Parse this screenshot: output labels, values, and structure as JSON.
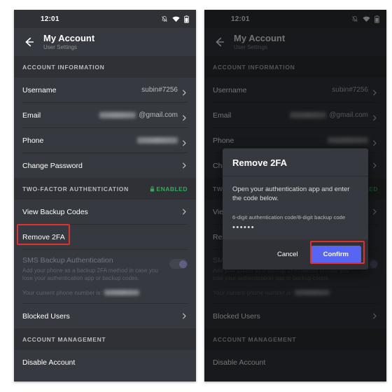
{
  "status_bar": {
    "time": "12:01",
    "icons": [
      "bell-muted-icon",
      "wifi-icon",
      "battery-icon"
    ]
  },
  "header": {
    "back_icon": "back-arrow-icon",
    "title": "My Account",
    "subtitle": "User Settings"
  },
  "sections": {
    "account_information": {
      "heading": "ACCOUNT INFORMATION",
      "rows": [
        {
          "label": "Username",
          "value": "subin#7256",
          "redacted": false,
          "chevron": true
        },
        {
          "label": "Email",
          "value": "@gmail.com",
          "redacted": true,
          "chevron": true
        },
        {
          "label": "Phone",
          "value": "",
          "redacted": true,
          "chevron": true
        },
        {
          "label": "Change Password",
          "value": "",
          "redacted": false,
          "chevron": true
        }
      ]
    },
    "two_factor": {
      "heading": "TWO-FACTOR AUTHENTICATION",
      "status_badge": "ENABLED",
      "status_icon": "lock-icon",
      "status_color": "#3ba55d",
      "rows": [
        {
          "label": "View Backup Codes",
          "chevron": true
        },
        {
          "label": "Remove 2FA",
          "chevron": false
        }
      ],
      "sms": {
        "title": "SMS Backup Authentication",
        "description": "Add your phone as a backup 2FA method in case you lose your authentication app or backup codes.",
        "toggle_on": true,
        "phone_line_prefix": "Your current phone number is:"
      },
      "blocked_users": {
        "label": "Blocked Users",
        "chevron": true
      }
    },
    "account_management": {
      "heading": "ACCOUNT MANAGEMENT",
      "rows": [
        {
          "label": "Disable Account",
          "chevron": false
        }
      ]
    }
  },
  "modal": {
    "title": "Remove 2FA",
    "body": "Open your authentication app and enter the code below.",
    "field_label": "6-digit authentication code/8-digit backup code",
    "field_value": "••••••",
    "cancel_label": "Cancel",
    "confirm_label": "Confirm",
    "confirm_color": "#5865f2"
  },
  "annotations": {
    "highlight_color": "#e03131",
    "targets": [
      "remove-2fa-row",
      "confirm-button"
    ]
  }
}
